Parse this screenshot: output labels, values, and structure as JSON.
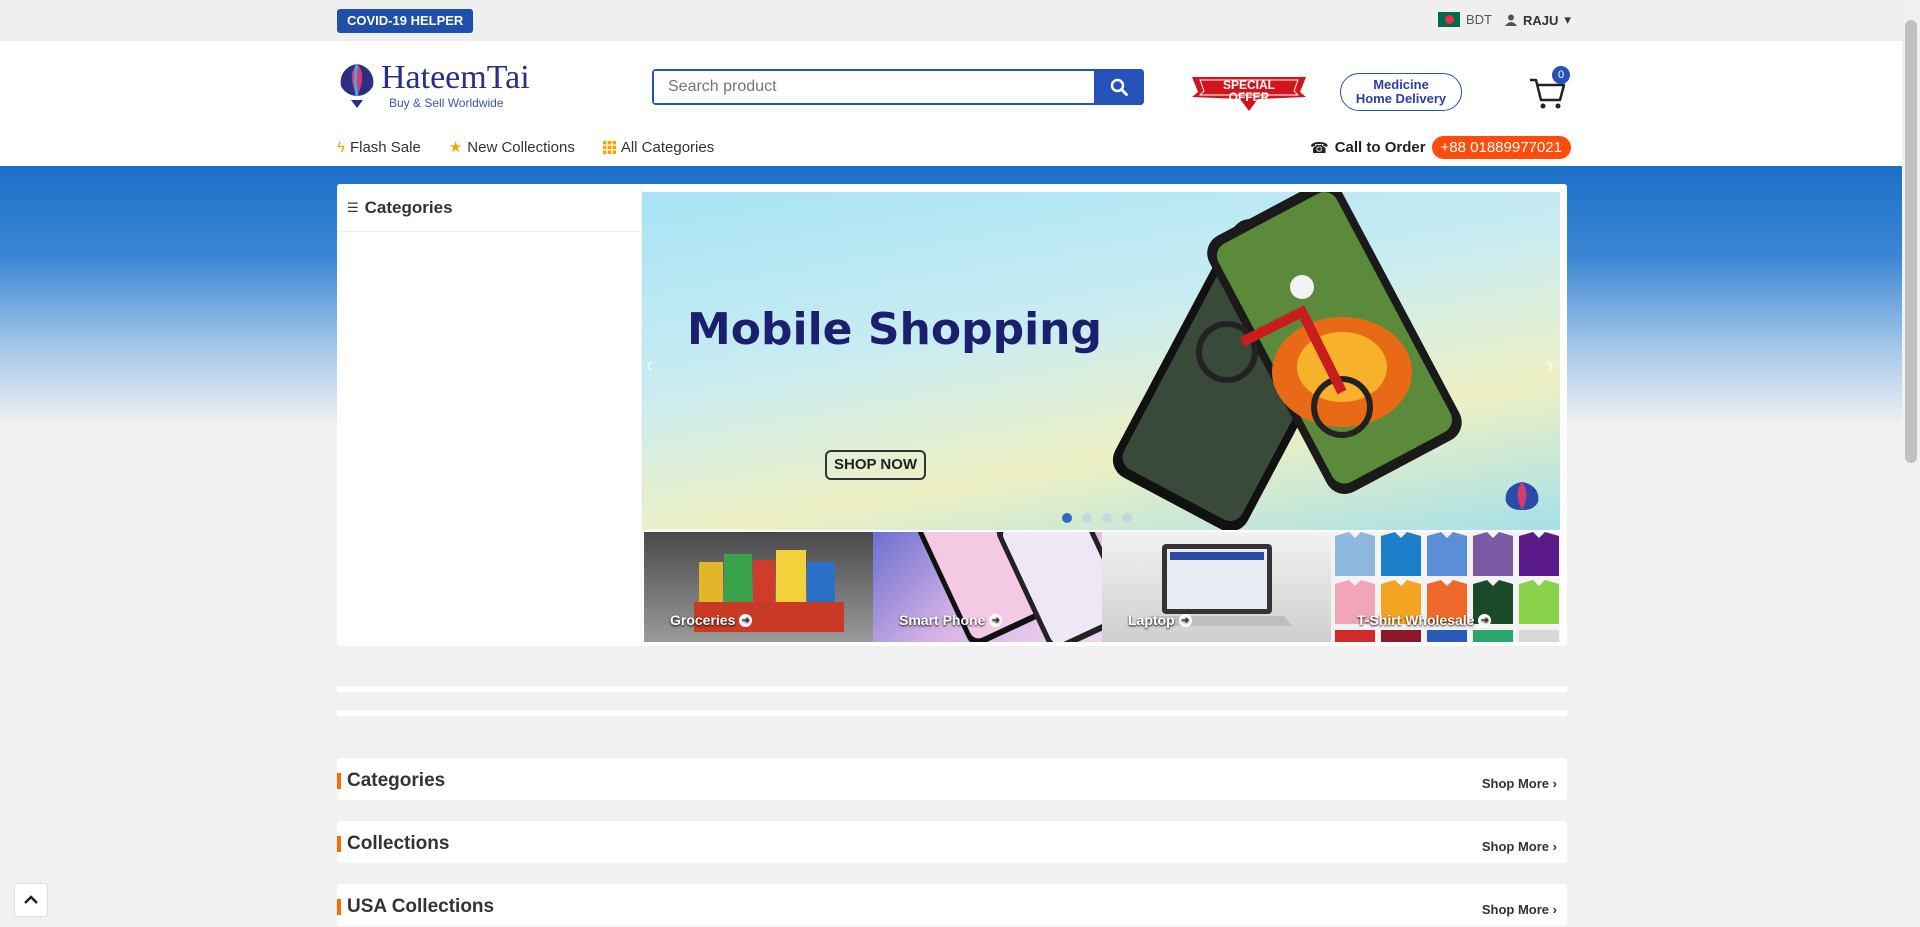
{
  "topbar": {
    "covid_label": "COVID-19 HELPER",
    "currency": "BDT",
    "user": "RAJU"
  },
  "header": {
    "logo_name": "HateemTai",
    "logo_tagline": "Buy & Sell Worldwide",
    "search_placeholder": "Search product",
    "special_offer": [
      "SPECIAL",
      "OFFER"
    ],
    "medicine": [
      "Medicine",
      "Home Delivery"
    ],
    "cart_count": "0"
  },
  "nav": {
    "flash_sale": "Flash Sale",
    "new_collections": "New Collections",
    "all_categories": "All Categories",
    "call_label": "Call to Order",
    "phone": "+88 01889977021"
  },
  "sidebar": {
    "title": "Categories"
  },
  "slider": {
    "title": "Mobile Shopping",
    "button": "SHOP NOW",
    "slide_count": 4,
    "active_slide": 1
  },
  "tiles": [
    {
      "label": "Groceries"
    },
    {
      "label": "Smart Phone"
    },
    {
      "label": "Laptop"
    },
    {
      "label": "T-Shirt Wholesale"
    }
  ],
  "sections": [
    {
      "title": "Categories",
      "more": "Shop More"
    },
    {
      "title": "Collections",
      "more": "Shop More"
    },
    {
      "title": "USA Collections",
      "more": "Shop More"
    }
  ],
  "colors": {
    "brand_blue": "#2452b8",
    "accent_orange": "#ff4b0b",
    "band_blue": "#1b6fc8"
  }
}
